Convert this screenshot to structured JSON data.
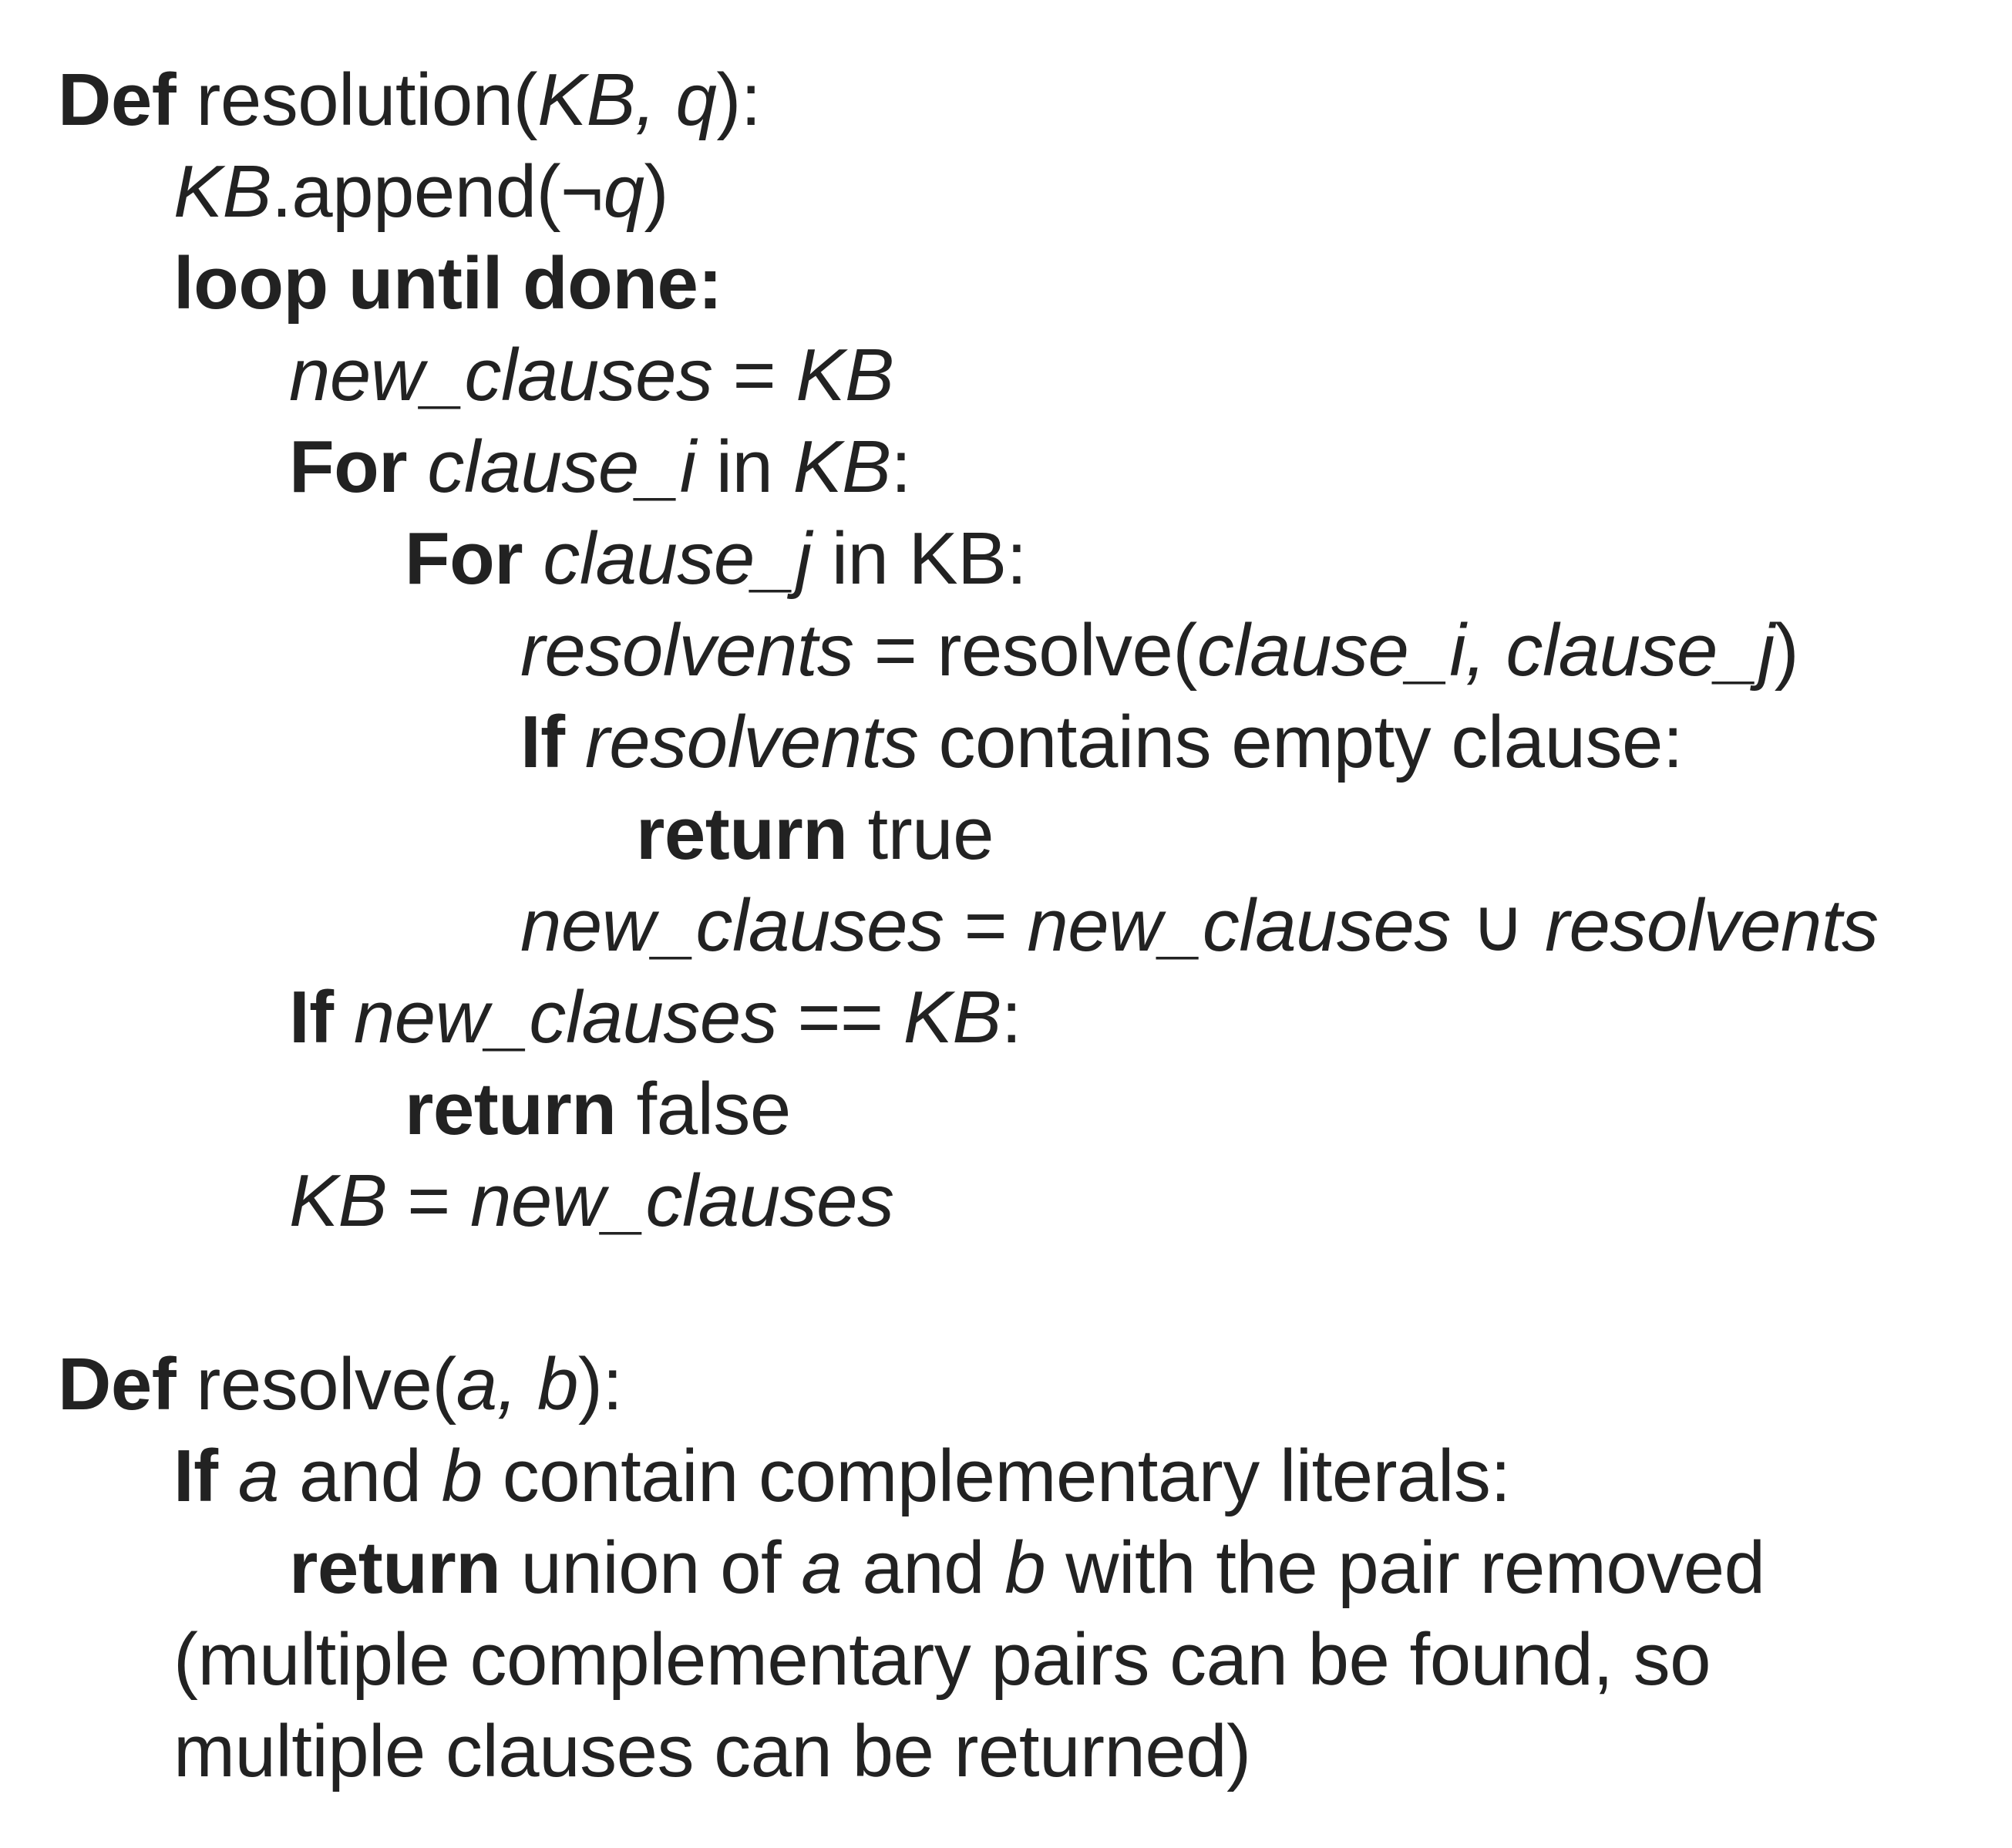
{
  "lines": [
    {
      "indent": 0,
      "tokens": [
        {
          "t": "Def",
          "s": "k"
        },
        {
          "t": " resolution(",
          "s": "t"
        },
        {
          "t": "KB, q",
          "s": "v"
        },
        {
          "t": "):",
          "s": "t"
        }
      ]
    },
    {
      "indent": 1,
      "tokens": [
        {
          "t": "KB",
          "s": "v"
        },
        {
          "t": ".append(¬",
          "s": "t"
        },
        {
          "t": "q",
          "s": "v"
        },
        {
          "t": ")",
          "s": "t"
        }
      ]
    },
    {
      "indent": 1,
      "tokens": [
        {
          "t": "loop until done:",
          "s": "k"
        }
      ]
    },
    {
      "indent": 2,
      "tokens": [
        {
          "t": "new_clauses",
          "s": "v"
        },
        {
          "t": " = ",
          "s": "t"
        },
        {
          "t": "KB",
          "s": "v"
        }
      ]
    },
    {
      "indent": 2,
      "tokens": [
        {
          "t": "For",
          "s": "k"
        },
        {
          "t": " ",
          "s": "t"
        },
        {
          "t": "clause_i",
          "s": "v"
        },
        {
          "t": " in ",
          "s": "t"
        },
        {
          "t": "KB",
          "s": "v"
        },
        {
          "t": ":",
          "s": "t"
        }
      ]
    },
    {
      "indent": 3,
      "tokens": [
        {
          "t": "For",
          "s": "k"
        },
        {
          "t": " ",
          "s": "t"
        },
        {
          "t": "clause_j",
          "s": "v"
        },
        {
          "t": " in KB:",
          "s": "t"
        }
      ]
    },
    {
      "indent": 4,
      "tokens": [
        {
          "t": "resolvents",
          "s": "v"
        },
        {
          "t": " = resolve(",
          "s": "t"
        },
        {
          "t": "clause_i, clause_j",
          "s": "v"
        },
        {
          "t": ")",
          "s": "t"
        }
      ]
    },
    {
      "indent": 4,
      "tokens": [
        {
          "t": "If",
          "s": "k"
        },
        {
          "t": " ",
          "s": "t"
        },
        {
          "t": "resolvents",
          "s": "v"
        },
        {
          "t": " contains empty clause:",
          "s": "t"
        }
      ]
    },
    {
      "indent": 5,
      "tokens": [
        {
          "t": "return",
          "s": "k"
        },
        {
          "t": " true",
          "s": "t"
        }
      ]
    },
    {
      "indent": 4,
      "tokens": [
        {
          "t": "new_clauses",
          "s": "v"
        },
        {
          "t": " = ",
          "s": "t"
        },
        {
          "t": "new_clauses",
          "s": "v"
        },
        {
          "t": " ∪ ",
          "s": "t"
        },
        {
          "t": "resolvents",
          "s": "v"
        }
      ]
    },
    {
      "indent": 2,
      "tokens": [
        {
          "t": "If",
          "s": "k"
        },
        {
          "t": " ",
          "s": "t"
        },
        {
          "t": "new_clauses",
          "s": "v"
        },
        {
          "t": " == ",
          "s": "t"
        },
        {
          "t": "KB",
          "s": "v"
        },
        {
          "t": ":",
          "s": "t"
        }
      ]
    },
    {
      "indent": 3,
      "tokens": [
        {
          "t": "return",
          "s": "k"
        },
        {
          "t": " false",
          "s": "t"
        }
      ]
    },
    {
      "indent": 2,
      "tokens": [
        {
          "t": "KB",
          "s": "v"
        },
        {
          "t": " = ",
          "s": "t"
        },
        {
          "t": "new_clauses",
          "s": "v"
        }
      ]
    },
    {
      "indent": 0,
      "tokens": []
    },
    {
      "indent": 0,
      "tokens": [
        {
          "t": "Def",
          "s": "k"
        },
        {
          "t": " resolve(",
          "s": "t"
        },
        {
          "t": "a, b",
          "s": "v"
        },
        {
          "t": "):",
          "s": "t"
        }
      ]
    },
    {
      "indent": 1,
      "tokens": [
        {
          "t": "If",
          "s": "k"
        },
        {
          "t": " ",
          "s": "t"
        },
        {
          "t": "a",
          "s": "v"
        },
        {
          "t": " and ",
          "s": "t"
        },
        {
          "t": "b",
          "s": "v"
        },
        {
          "t": " contain complementary literals:",
          "s": "t"
        }
      ]
    },
    {
      "indent": 2,
      "tokens": [
        {
          "t": "return",
          "s": "k"
        },
        {
          "t": " union of ",
          "s": "t"
        },
        {
          "t": "a",
          "s": "v"
        },
        {
          "t": " and ",
          "s": "t"
        },
        {
          "t": "b",
          "s": "v"
        },
        {
          "t": " with the pair removed",
          "s": "t"
        }
      ]
    },
    {
      "indent": 1,
      "tokens": [
        {
          "t": "(multiple complementary pairs can be found, so",
          "s": "t"
        }
      ]
    },
    {
      "indent": 1,
      "tokens": [
        {
          "t": "multiple clauses can be returned)",
          "s": "t"
        }
      ]
    }
  ]
}
